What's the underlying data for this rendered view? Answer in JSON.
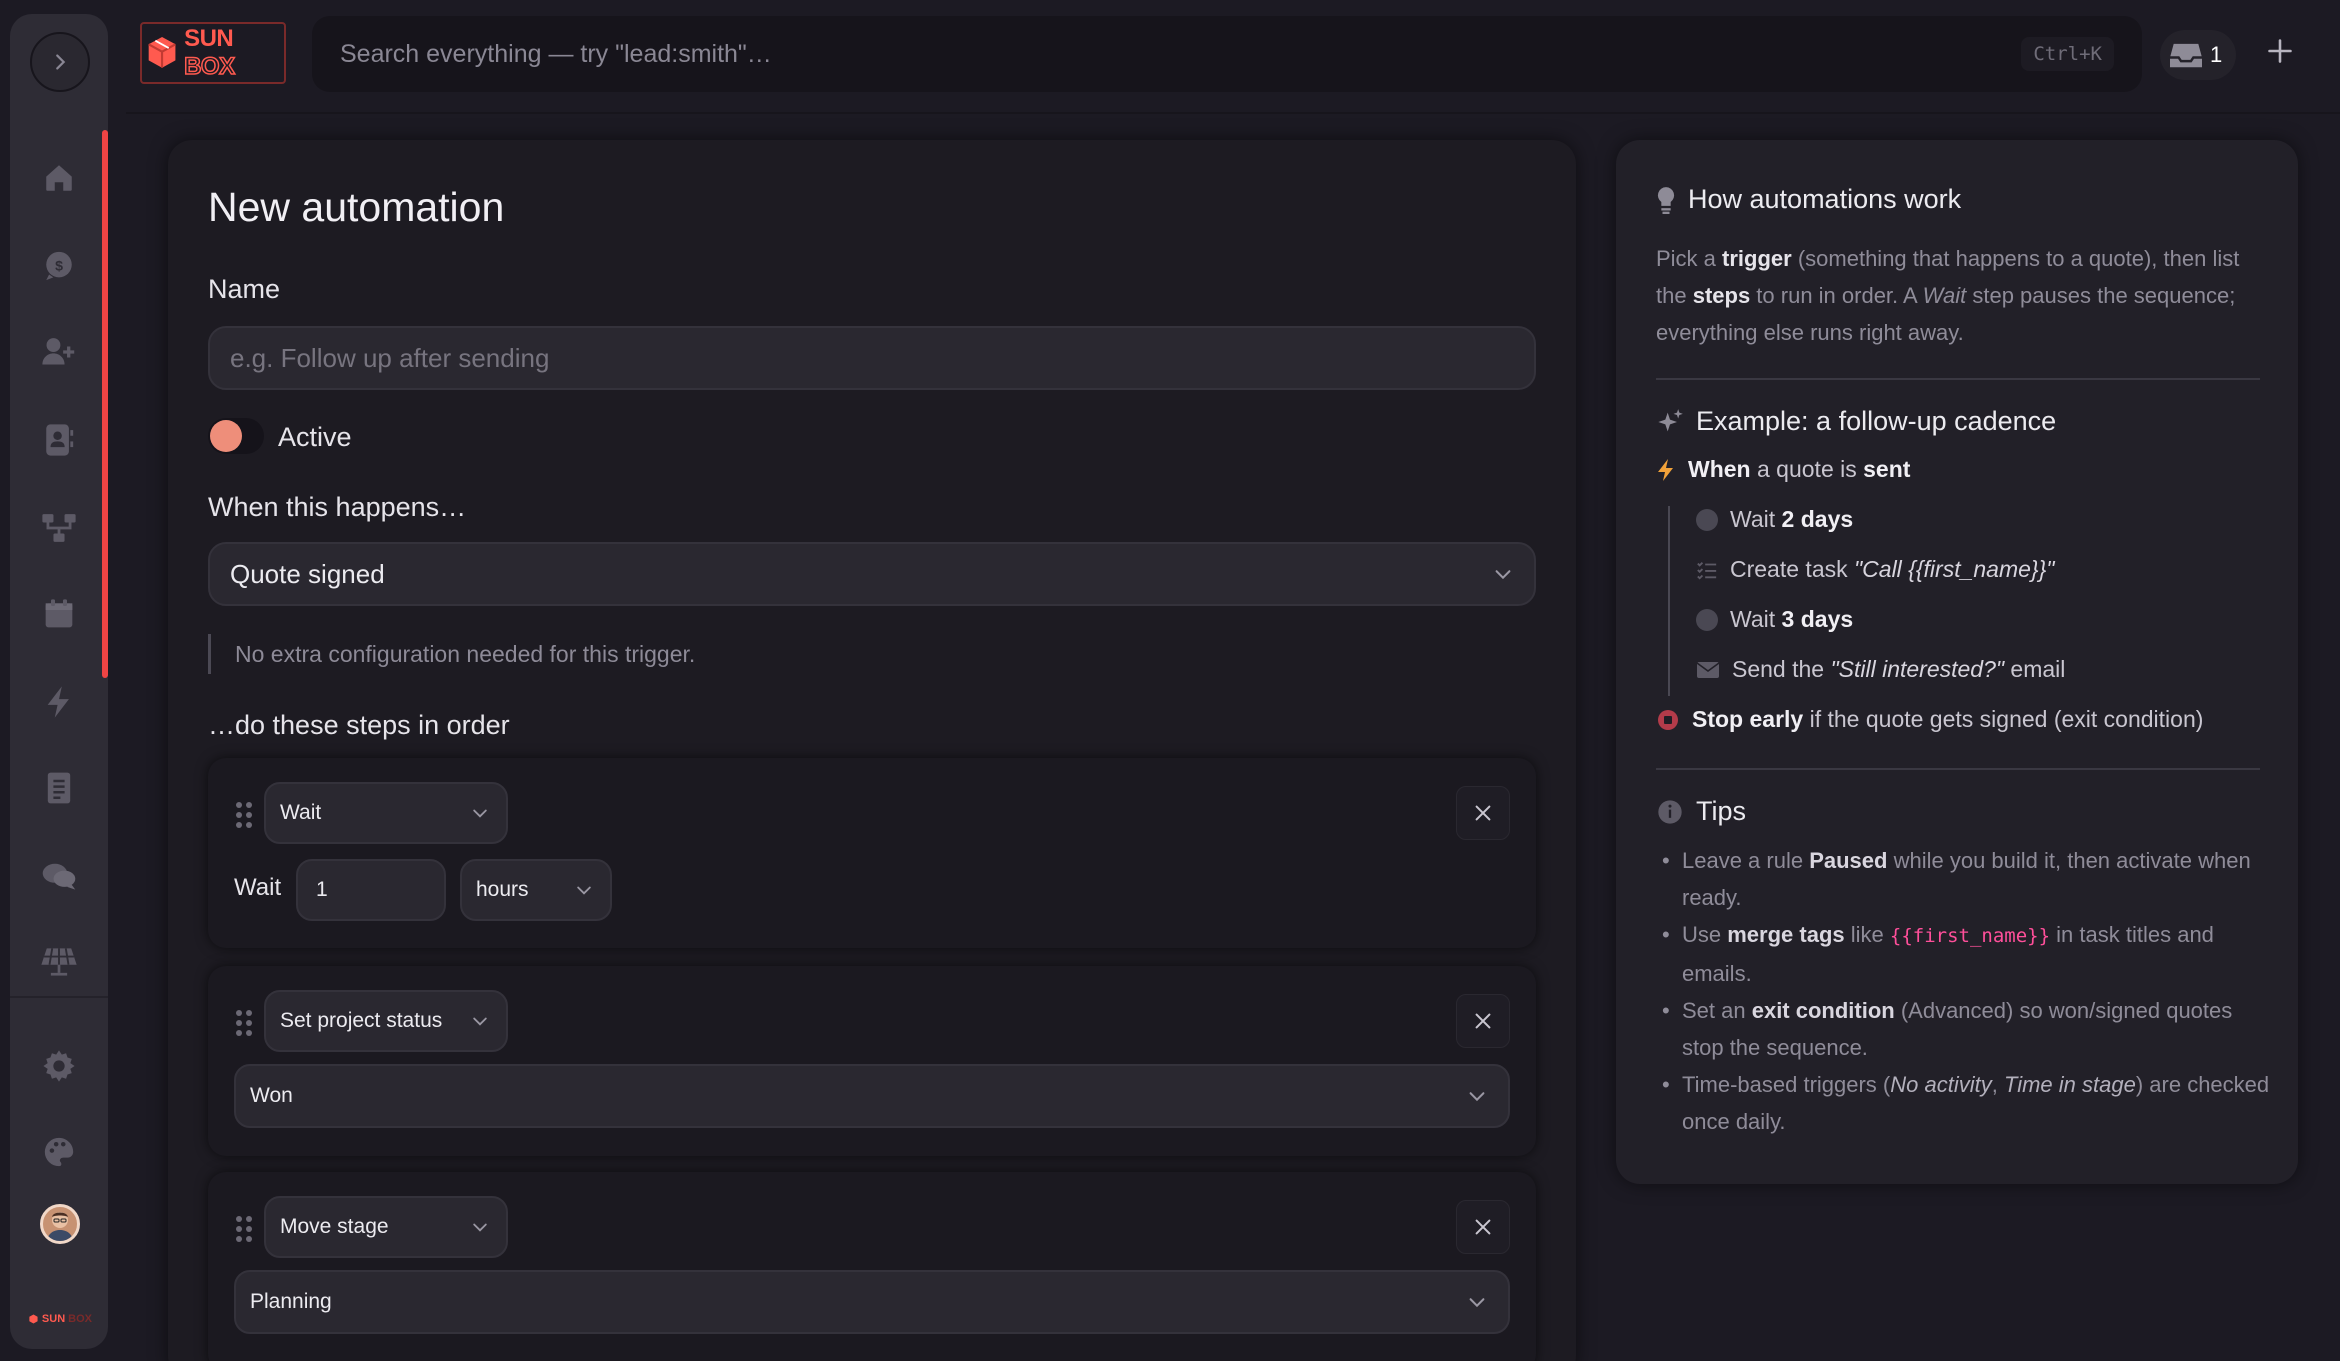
{
  "brand": {
    "sun": "SUN",
    "box": "BOX",
    "accent": "#ff5a4f"
  },
  "search": {
    "placeholder": "Search everything — try \"lead:smith\"…",
    "shortcut": "Ctrl+K"
  },
  "inbox": {
    "count": "1"
  },
  "rail": {
    "items": [
      "home-icon",
      "chat-bubble-icon",
      "add-user-icon",
      "contacts-icon",
      "workflow-icon",
      "calendar-icon",
      "lightning-icon",
      "document-icon",
      "messages-icon",
      "solar-panel-icon",
      "gear-icon",
      "palette-icon"
    ]
  },
  "form": {
    "title": "New automation",
    "name_label": "Name",
    "name_placeholder": "e.g. Follow up after sending",
    "active_label": "Active",
    "trigger_label": "When this happens…",
    "trigger_value": "Quote signed",
    "trigger_note": "No extra configuration needed for this trigger.",
    "steps_label": "…do these steps in order",
    "steps": [
      {
        "type": "Wait",
        "wait_label": "Wait",
        "amount": "1",
        "unit": "hours"
      },
      {
        "type": "Set project status",
        "value": "Won"
      },
      {
        "type": "Move stage",
        "value": "Planning"
      }
    ]
  },
  "help": {
    "title": "How automations work",
    "intro": {
      "p1": "Pick a ",
      "b1": "trigger",
      "p2": " (something that happens to a quote), then list the ",
      "b2": "steps",
      "p3": " to run in order. A ",
      "i1": "Wait",
      "p4": " step pauses the sequence; everything else runs right away."
    },
    "example_title": "Example: a follow-up cadence",
    "example": {
      "when_b": "When",
      "when_mid": " a quote is ",
      "when_end": "sent",
      "wait1_a": "Wait ",
      "wait1_b": "2 days",
      "task_a": "Create task ",
      "task_i": "\"Call {{first_name}}\"",
      "wait2_a": "Wait ",
      "wait2_b": "3 days",
      "send_a": "Send the ",
      "send_i": "\"Still interested?\"",
      "send_c": " email",
      "stop_b": "Stop early",
      "stop_rest": " if the quote gets signed (exit condition)"
    },
    "tips_title": "Tips",
    "tips": {
      "t1a": "Leave a rule ",
      "t1b": "Paused",
      "t1c": " while you build it, then activate when ready.",
      "t2a": "Use ",
      "t2b": "merge tags",
      "t2c": " like ",
      "t2code": "{{first_name}}",
      "t2d": " in task titles and emails.",
      "t3a": "Set an ",
      "t3b": "exit condition",
      "t3c": " (Advanced) so won/signed quotes stop the sequence.",
      "t4a": "Time-based triggers (",
      "t4i1": "No activity",
      "t4b": ", ",
      "t4i2": "Time in stage",
      "t4c": ") are checked once daily."
    }
  }
}
